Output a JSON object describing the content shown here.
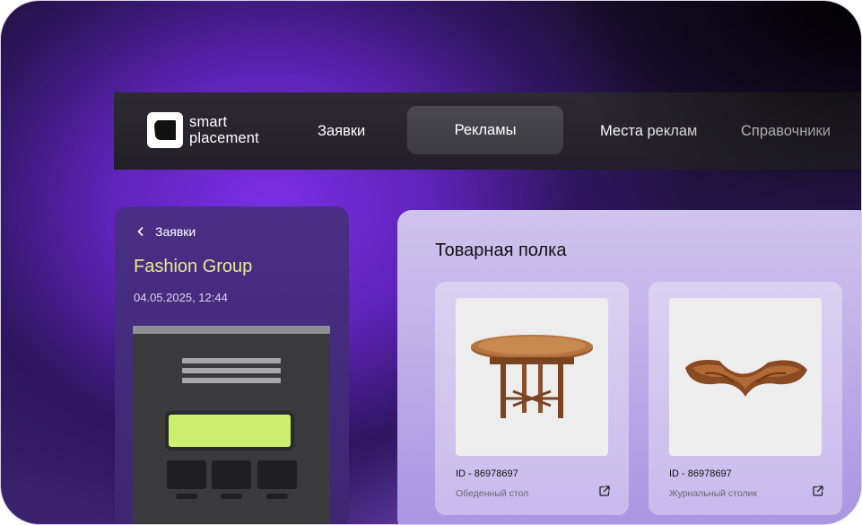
{
  "brand": {
    "line1": "smart",
    "line2": "placement"
  },
  "nav": {
    "items": [
      {
        "label": "Заявки"
      },
      {
        "label": "Рекламы"
      },
      {
        "label": "Места реклам"
      },
      {
        "label": "Справочники"
      }
    ],
    "active_index": 1
  },
  "left_panel": {
    "back_label": "Заявки",
    "company": "Fashion Group",
    "datetime": "04.05.2025, 12:44"
  },
  "shelf": {
    "title": "Товарная полка",
    "products": [
      {
        "id": "ID - 86978697",
        "name": "Обеденный стол",
        "image": "round-wooden-dining-table"
      },
      {
        "id": "ID - 86978697",
        "name": "Журнальный столик",
        "image": "sculptural-wooden-coffee-table"
      }
    ]
  },
  "icons": {
    "logo": "smart-placement-logo-icon",
    "back": "chevron-left-icon",
    "external": "external-link-icon"
  },
  "colors": {
    "accent_lime": "#ccef6e",
    "company_text": "#e4ee8a",
    "navbar_bg": "#2d2a33",
    "active_tab_bg": "#4b4950",
    "background_purple": "#6a2bd0"
  }
}
